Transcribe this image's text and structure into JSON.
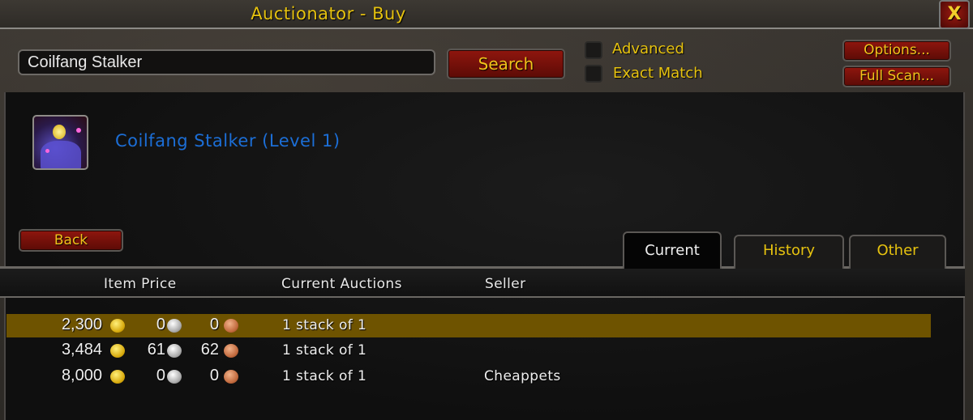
{
  "window": {
    "title": "Auctionator - Buy",
    "close_label": "X"
  },
  "toolbar": {
    "search_value": "Coilfang Stalker",
    "search_label": "Search",
    "advanced_label": "Advanced",
    "advanced_checked": false,
    "exact_match_label": "Exact Match",
    "exact_match_checked": false,
    "options_label": "Options...",
    "full_scan_label": "Full Scan..."
  },
  "item": {
    "name": "Coilfang Stalker (Level 1)",
    "icon": "coilfang-stalker-pet-icon",
    "name_color": "#1c6ed6"
  },
  "back_label": "Back",
  "tabs": [
    {
      "label": "Current",
      "active": true
    },
    {
      "label": "History",
      "active": false
    },
    {
      "label": "Other",
      "active": false
    }
  ],
  "table": {
    "columns": [
      "Item Price",
      "Current Auctions",
      "Seller"
    ],
    "rows": [
      {
        "gold": "2,300",
        "silver": "0",
        "copper": "0",
        "auctions": "1 stack of 1",
        "seller": "",
        "selected": true
      },
      {
        "gold": "3,484",
        "silver": "61",
        "copper": "62",
        "auctions": "1 stack of 1",
        "seller": "",
        "selected": false
      },
      {
        "gold": "8,000",
        "silver": "0",
        "copper": "0",
        "auctions": "1 stack of 1",
        "seller": "Cheappets",
        "selected": false
      }
    ]
  },
  "colors": {
    "accent_gold_text": "#e6c20f",
    "button_red": "#8f160e",
    "selected_row": "#6e5300"
  }
}
